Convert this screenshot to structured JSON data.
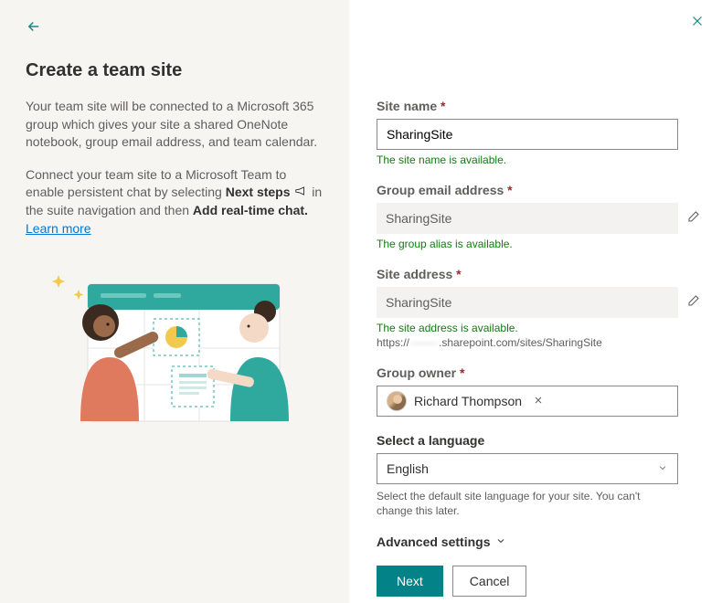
{
  "left": {
    "title": "Create a team site",
    "para1": "Your team site will be connected to a Microsoft 365 group which gives your site a shared OneNote notebook, group email address, and team calendar.",
    "para2_prefix": "Connect your team site to a Microsoft Team to enable persistent chat by selecting ",
    "para2_bold1": "Next steps",
    "para2_mid": " in the suite navigation and then ",
    "para2_bold2": "Add real-time chat.",
    "learn_more": "Learn more"
  },
  "form": {
    "site_name": {
      "label": "Site name",
      "value": "SharingSite",
      "validation": "The site name is available."
    },
    "group_email": {
      "label": "Group email address",
      "value": "SharingSite",
      "validation": "The group alias is available."
    },
    "site_address": {
      "label": "Site address",
      "value": "SharingSite",
      "validation": "The site address is available.",
      "url_prefix": "https://",
      "url_hidden": "--------",
      "url_suffix": ".sharepoint.com/sites/SharingSite"
    },
    "owner": {
      "label": "Group owner",
      "name": "Richard Thompson"
    },
    "language": {
      "label": "Select a language",
      "value": "English",
      "help": "Select the default site language for your site. You can't change this later."
    },
    "advanced_label": "Advanced settings",
    "next": "Next",
    "cancel": "Cancel"
  }
}
